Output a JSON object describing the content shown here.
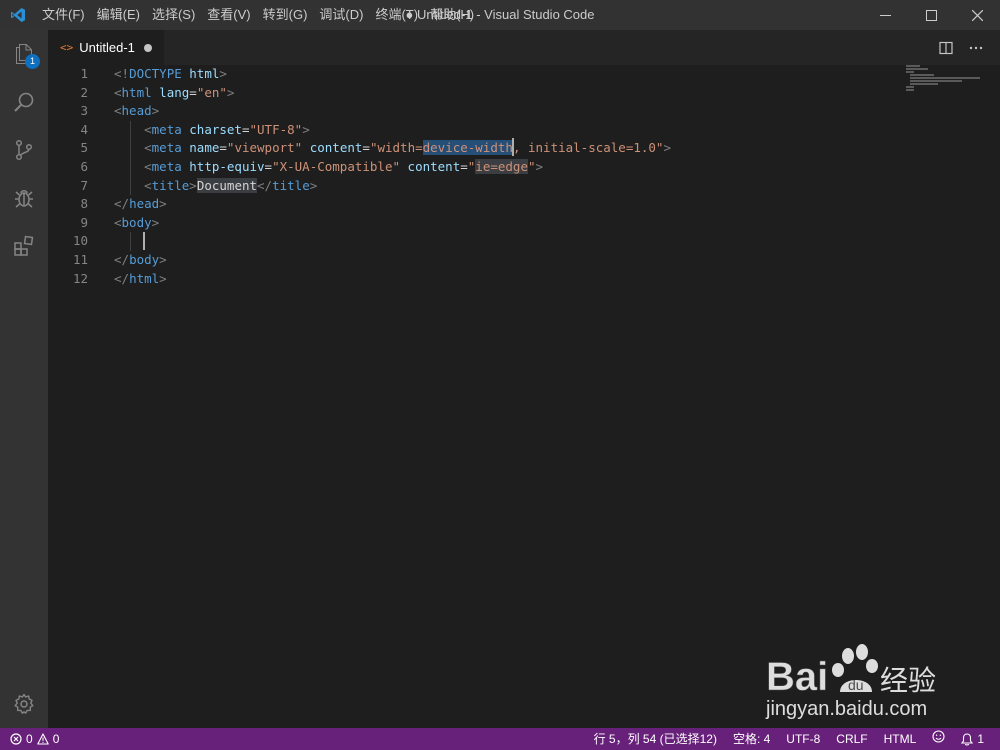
{
  "window": {
    "title": "● Untitled-1 - Visual Studio Code",
    "menu": [
      "文件(F)",
      "编辑(E)",
      "选择(S)",
      "查看(V)",
      "转到(G)",
      "调试(D)",
      "终端(T)",
      "帮助(H)"
    ]
  },
  "activity": {
    "explorer_badge": "1"
  },
  "tab": {
    "label": "Untitled-1"
  },
  "editor": {
    "line_numbers": [
      "1",
      "2",
      "3",
      "4",
      "5",
      "6",
      "7",
      "8",
      "9",
      "10",
      "11",
      "12"
    ]
  },
  "status": {
    "errors": "0",
    "warnings": "0",
    "position": "行 5，列 54 (已选择12)",
    "spaces": "空格: 4",
    "encoding": "UTF-8",
    "eol": "CRLF",
    "language": "HTML",
    "notifications": "1"
  },
  "watermark": {
    "brand": "Bai 经验",
    "url": "jingyan.baidu.com"
  },
  "colors": {
    "statusbar": "#68217a",
    "activitybar": "#333333",
    "editor_bg": "#1e1e1e",
    "badge": "#0e70c0"
  },
  "icons": {
    "activity": [
      "files-icon",
      "search-icon",
      "source-control-icon",
      "debug-icon",
      "extensions-icon",
      "settings-gear-icon"
    ]
  }
}
